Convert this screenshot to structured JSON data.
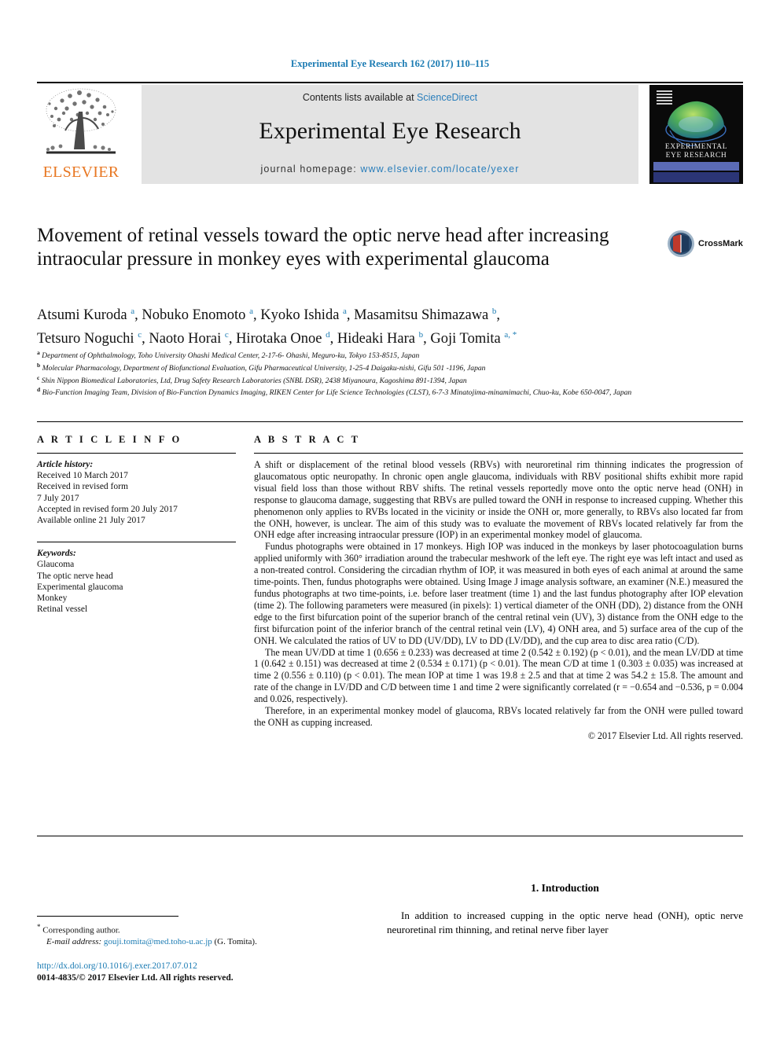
{
  "running_head": "Experimental Eye Research 162 (2017) 110–115",
  "masthead": {
    "publisher_name": "ELSEVIER",
    "contents_prefix": "Contents lists available at ",
    "contents_link": "ScienceDirect",
    "journal_title": "Experimental Eye Research",
    "homepage_prefix": "journal homepage: ",
    "homepage_url": "www.elsevier.com/locate/yexer",
    "cover_title_line1": "EXPERIMENTAL",
    "cover_title_line2": "EYE RESEARCH",
    "accent_link_color": "#2a7ebb",
    "publisher_color": "#e87722"
  },
  "article": {
    "title": "Movement of retinal vessels toward the optic nerve head after increasing intraocular pressure in monkey eyes with experimental glaucoma",
    "crossmark_label": "CrossMark",
    "authors": [
      {
        "name": "Atsumi Kuroda",
        "marks": "a"
      },
      {
        "name": "Nobuko Enomoto",
        "marks": "a"
      },
      {
        "name": "Kyoko Ishida",
        "marks": "a"
      },
      {
        "name": "Masamitsu Shimazawa",
        "marks": "b"
      },
      {
        "name": "Tetsuro Noguchi",
        "marks": "c"
      },
      {
        "name": "Naoto Horai",
        "marks": "c"
      },
      {
        "name": "Hirotaka Onoe",
        "marks": "d"
      },
      {
        "name": "Hideaki Hara",
        "marks": "b"
      },
      {
        "name": "Goji Tomita",
        "marks": "a, *"
      }
    ],
    "affiliations": [
      {
        "mark": "a",
        "text": "Department of Ophthalmology, Toho University Ohashi Medical Center, 2-17-6- Ohashi, Meguro-ku, Tokyo 153-8515, Japan"
      },
      {
        "mark": "b",
        "text": "Molecular Pharmacology, Department of Biofunctional Evaluation, Gifu Pharmaceutical University, 1-25-4 Daigaku-nishi, Gifu 501 -1196, Japan"
      },
      {
        "mark": "c",
        "text": "Shin Nippon Biomedical Laboratories, Ltd, Drug Safety Research Laboratories (SNBL DSR), 2438 Miyanoura, Kagoshima 891-1394, Japan"
      },
      {
        "mark": "d",
        "text": "Bio-Function Imaging Team, Division of Bio-Function Dynamics Imaging, RIKEN Center for Life Science Technologies (CLST), 6-7-3 Minatojima-minamimachi, Chuo-ku, Kobe 650-0047, Japan"
      }
    ]
  },
  "article_info": {
    "heading": "A R T I C L E   I N F O",
    "history_label": "Article history:",
    "history": [
      "Received 10 March 2017",
      "Received in revised form",
      "7 July 2017",
      "Accepted in revised form 20 July 2017",
      "Available online 21 July 2017"
    ],
    "keywords_label": "Keywords:",
    "keywords": [
      "Glaucoma",
      "The optic nerve head",
      "Experimental glaucoma",
      "Monkey",
      "Retinal vessel"
    ]
  },
  "abstract": {
    "heading": "A B S T R A C T",
    "paragraphs": [
      "A shift or displacement of the retinal blood vessels (RBVs) with neuroretinal rim thinning indicates the progression of glaucomatous optic neuropathy. In chronic open angle glaucoma, individuals with RBV positional shifts exhibit more rapid visual field loss than those without RBV shifts. The retinal vessels reportedly move onto the optic nerve head (ONH) in response to glaucoma damage, suggesting that RBVs are pulled toward the ONH in response to increased cupping. Whether this phenomenon only applies to RVBs located in the vicinity or inside the ONH or, more generally, to RBVs also located far from the ONH, however, is unclear. The aim of this study was to evaluate the movement of RBVs located relatively far from the ONH edge after increasing intraocular pressure (IOP) in an experimental monkey model of glaucoma.",
      "Fundus photographs were obtained in 17 monkeys. High IOP was induced in the monkeys by laser photocoagulation burns applied uniformly with 360° irradiation around the trabecular meshwork of the left eye. The right eye was left intact and used as a non-treated control. Considering the circadian rhythm of IOP, it was measured in both eyes of each animal at around the same time-points. Then, fundus photographs were obtained. Using Image J image analysis software, an examiner (N.E.) measured the fundus photographs at two time-points, i.e. before laser treatment (time 1) and the last fundus photography after IOP elevation (time 2). The following parameters were measured (in pixels): 1) vertical diameter of the ONH (DD), 2) distance from the ONH edge to the first bifurcation point of the superior branch of the central retinal vein (UV), 3) distance from the ONH edge to the first bifurcation point of the inferior branch of the central retinal vein (LV), 4) ONH area, and 5) surface area of the cup of the ONH. We calculated the ratios of UV to DD (UV/DD), LV to DD (LV/DD), and the cup area to disc area ratio (C/D).",
      "The mean UV/DD at time 1 (0.656 ± 0.233) was decreased at time 2 (0.542 ± 0.192) (p < 0.01), and the mean LV/DD at time 1 (0.642 ± 0.151) was decreased at time 2 (0.534 ± 0.171) (p < 0.01). The mean C/D at time 1 (0.303 ± 0.035) was increased at time 2 (0.556 ± 0.110) (p < 0.01). The mean IOP at time 1 was 19.8 ± 2.5 and that at time 2 was 54.2 ± 15.8. The amount and rate of the change in LV/DD and C/D between time 1 and time 2 were significantly correlated (r = −0.654 and −0.536, p = 0.004 and 0.026, respectively).",
      "Therefore, in an experimental monkey model of glaucoma, RBVs located relatively far from the ONH were pulled toward the ONH as cupping increased."
    ],
    "copyright": "© 2017 Elsevier Ltd. All rights reserved."
  },
  "introduction": {
    "heading": "1.  Introduction",
    "paragraph": "In addition to increased cupping in the optic nerve head (ONH), optic nerve neuroretinal rim thinning, and retinal nerve fiber layer"
  },
  "footnotes": {
    "corresponding_label": "Corresponding author.",
    "email_label": "E-mail address:",
    "email": "gouji.tomita@med.toho-u.ac.jp",
    "email_owner": "(G. Tomita).",
    "doi_url": "http://dx.doi.org/10.1016/j.exer.2017.07.012",
    "issn_line": "0014-4835/© 2017 Elsevier Ltd. All rights reserved."
  }
}
